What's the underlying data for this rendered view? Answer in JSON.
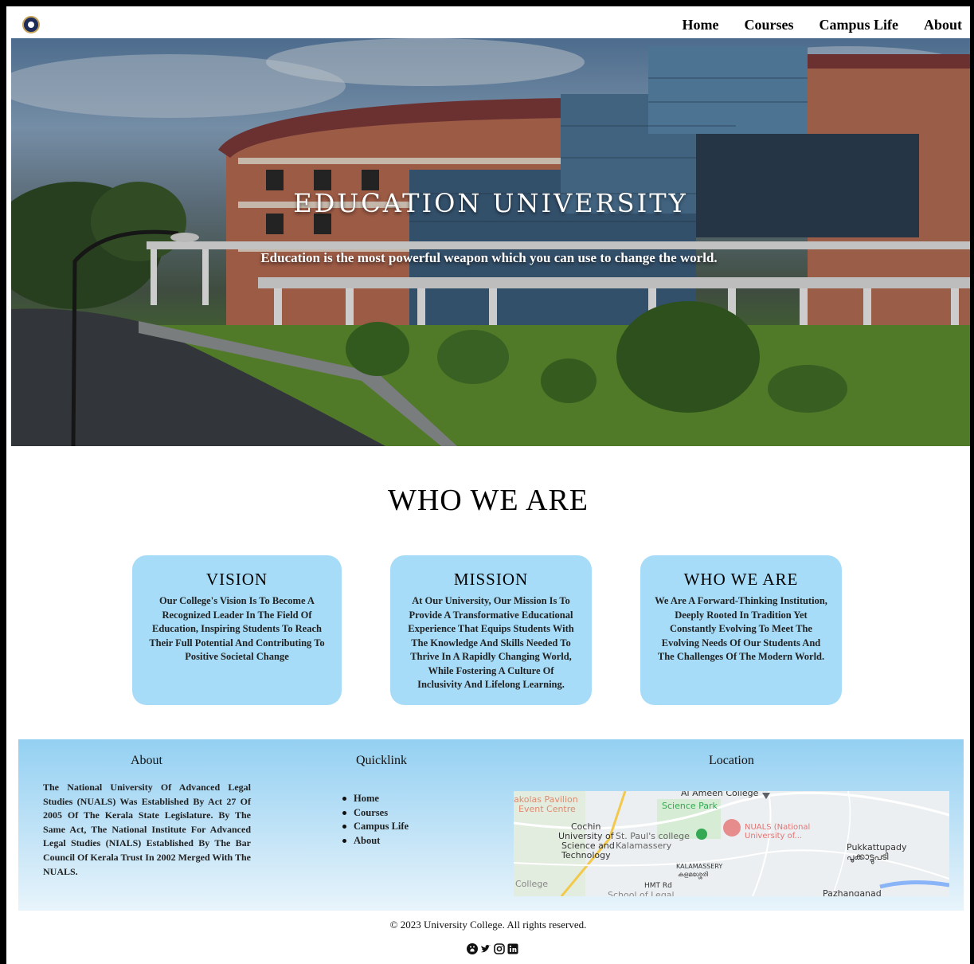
{
  "nav": {
    "items": [
      {
        "label": "Home"
      },
      {
        "label": "Courses"
      },
      {
        "label": "Campus Life"
      },
      {
        "label": "About"
      }
    ]
  },
  "hero": {
    "title": "EDUCATION UNIVERSITY",
    "subtitle": "Education is the most powerful weapon which you can use to change the world."
  },
  "who": {
    "title": "WHO WE ARE",
    "cards": [
      {
        "title": "VISION",
        "text": "Our College's Vision Is To Become A Recognized Leader In The Field Of Education, Inspiring Students To Reach Their Full Potential And Contributing To Positive Societal Change"
      },
      {
        "title": "MISSION",
        "text": "At Our University, Our Mission Is To Provide A Transformative Educational Experience That Equips Students With The Knowledge And Skills Needed To Thrive In A Rapidly Changing World, While Fostering A Culture Of Inclusivity And Lifelong Learning."
      },
      {
        "title": "WHO WE ARE",
        "text": "We Are A Forward-Thinking Institution, Deeply Rooted In Tradition Yet Constantly Evolving To Meet The Evolving Needs Of Our Students And The Challenges Of The Modern World."
      }
    ]
  },
  "footer": {
    "about_heading": "About",
    "about_text": "The National University Of Advanced Legal Studies (NUALS) Was Established By Act 27 Of 2005 Of The Kerala State Legislature. By The Same Act, The National Institute For Advanced Legal Studies (NIALS) Established By The Bar Council Of Kerala Trust In 2002 Merged With The NUALS.",
    "quicklink_heading": "Quicklink",
    "quicklinks": [
      "Home",
      "Courses",
      "Campus Life",
      "About"
    ],
    "location_heading": "Location",
    "map_labels": {
      "al_ameen": "Al Ameen College",
      "science_park": "Science Park",
      "cochin": "Cochin",
      "university_of": "University of",
      "science_and": "Science and",
      "technology": "Technology",
      "pauls": "St. Paul's college",
      "kalamassery": "Kalamassery",
      "nuals": "NUALS (National University of...",
      "pukkattupady": "Pukkattupady",
      "pukkattupady_ml": "പൂക്കാട്ടുപടി",
      "kalamassery_caps": "KALAMASSERY",
      "kalamassery_ml": "കളമശ്ശേരി",
      "hmt": "HMT Rd",
      "pazhanganad": "Pazhanganad",
      "college": "College",
      "school_of_legal": "School of Legal",
      "akolas": "akolas Pavilion",
      "event_centre": "Event Centre"
    },
    "copyright": "© 2023 University College. All rights reserved.",
    "social_icons": [
      "github-icon",
      "twitter-icon",
      "instagram-icon",
      "linkedin-icon"
    ]
  }
}
